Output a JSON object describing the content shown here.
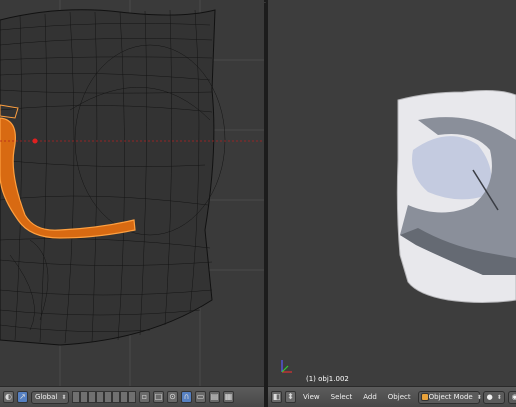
{
  "viewport_right": {
    "object_label": "(1) obj1.002"
  },
  "header_left": {
    "orientation_value": "Global"
  },
  "header_right": {
    "menus": [
      "View",
      "Select",
      "Add",
      "Object"
    ],
    "mode_value": "Object Mode"
  },
  "colors": {
    "selection_orange": "#ff8c1a",
    "wire": "#0a0a0a",
    "viewport_bg": "#3a3a3a",
    "header_bg": "#4d4d4d"
  },
  "icons": [
    "view-type-icon",
    "snap-icon",
    "pivot-icon",
    "manipulator-icon",
    "layers-grid",
    "render-icon",
    "viewport-shading-icon",
    "axis-gizmo"
  ]
}
